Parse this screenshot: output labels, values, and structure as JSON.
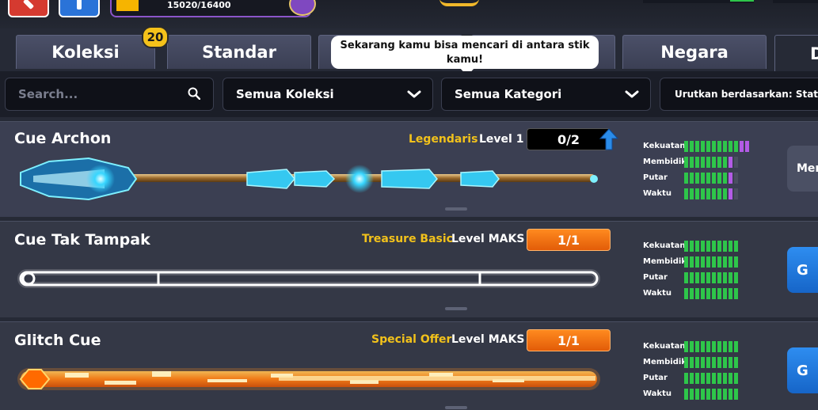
{
  "header": {
    "xp_text": "15020/16400"
  },
  "tabs": [
    {
      "label": "Koleksi"
    },
    {
      "label": "Standar"
    },
    {
      "label": ""
    },
    {
      "label": ""
    },
    {
      "label": "Negara"
    },
    {
      "label": "D"
    }
  ],
  "badge": "20",
  "tooltip": "Sekarang kamu bisa mencari di antara stik kamu!",
  "filters": {
    "search_placeholder": "Search...",
    "collection": "Semua Koleksi",
    "category": "Semua Kategori",
    "sort_label": "Urutkan berdasarkan: Statis"
  },
  "stat_labels": [
    "Kekuatan",
    "Membidik",
    "Putar",
    "Waktu"
  ],
  "cues": [
    {
      "name": "Cue Archon",
      "rarity": "Legendaris",
      "rarity_color": "#f2c21b",
      "level": "Level 1",
      "progress": "0/2",
      "action": "Mer",
      "stats": [
        {
          "green": 10,
          "purple": 2
        },
        {
          "green": 8,
          "purple": 1
        },
        {
          "green": 8,
          "purple": 1
        },
        {
          "green": 8,
          "purple": 1
        }
      ]
    },
    {
      "name": "Cue Tak Tampak",
      "rarity": "Treasure Basic",
      "rarity_color": "#f2c21b",
      "level": "Level MAKS",
      "progress": "1/1",
      "action": "G",
      "stats": [
        {
          "green": 10,
          "purple": 0
        },
        {
          "green": 10,
          "purple": 0
        },
        {
          "green": 10,
          "purple": 0
        },
        {
          "green": 10,
          "purple": 0
        }
      ]
    },
    {
      "name": "Glitch Cue",
      "rarity": "Special Offer",
      "rarity_color": "#f2c21b",
      "level": "Level MAKS",
      "progress": "1/1",
      "action": "G",
      "stats": [
        {
          "green": 10,
          "purple": 0
        },
        {
          "green": 10,
          "purple": 0
        },
        {
          "green": 10,
          "purple": 0
        },
        {
          "green": 10,
          "purple": 0
        }
      ]
    }
  ]
}
